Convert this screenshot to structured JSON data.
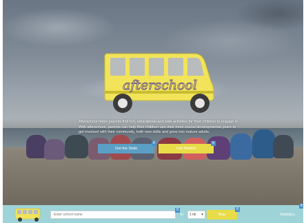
{
  "hero": {
    "description": "Afterschool helps parents find fun, educational and safe activities for their children to engage in. With afterschool, parents can help their children use their most crucial developmental years to get involved with their community, both new skills and grow into mature adults.",
    "logo_word": "afterschool",
    "btn_state": "Get the Stats",
    "btn_started": "Get Started"
  },
  "searchbar": {
    "placeholder": "Enter school name",
    "in_label": "in",
    "radius_value": "1 mi",
    "map_label": "Map",
    "stats_label": "Statistics"
  },
  "colors": {
    "accent_yellow": "#e8dc48",
    "accent_blue": "#5b9fc4",
    "bar_teal": "#9ed3d8",
    "badge_blue": "#4a8fcc"
  },
  "icons": {
    "logo": "school-bus-icon",
    "select_arrow": "chevron-down-icon"
  }
}
